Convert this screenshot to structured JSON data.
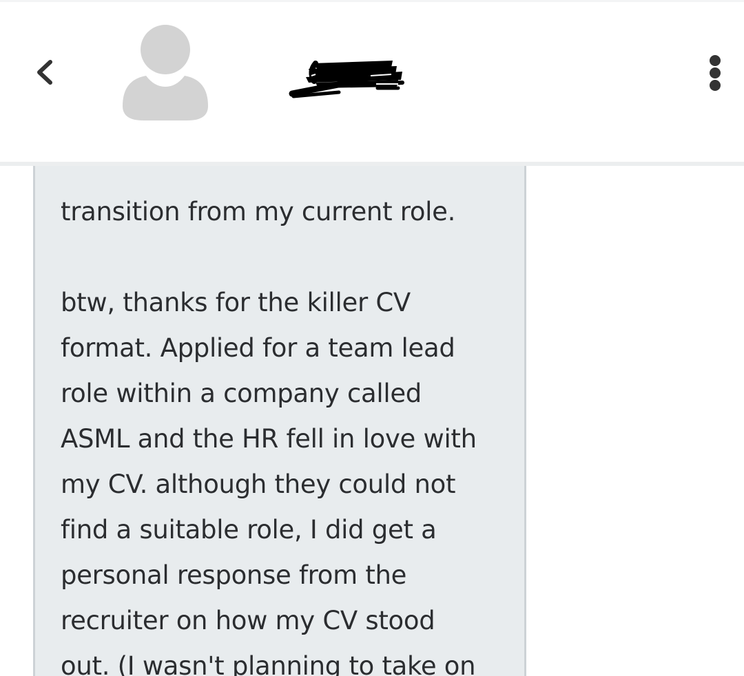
{
  "header": {
    "back_icon": "chevron-left-icon",
    "avatar_icon": "default-user-avatar",
    "contact_name": "",
    "more_icon": "vertical-ellipsis-icon"
  },
  "message": {
    "text": "transition from my current role.\n\nbtw, thanks for the killer CV\nformat. Applied for a team lead\nrole within a company called\nASML and the HR fell in love with\nmy CV. although they could not\nfind a suitable role, I did get a\npersonal response from the\nrecruiter on how my CV stood\nout. (I wasn't planning to take on"
  },
  "colors": {
    "bubble_background": "#e8ecee",
    "text": "#2b2d30",
    "icon": "#333333",
    "avatar": "#d3d3d3"
  }
}
